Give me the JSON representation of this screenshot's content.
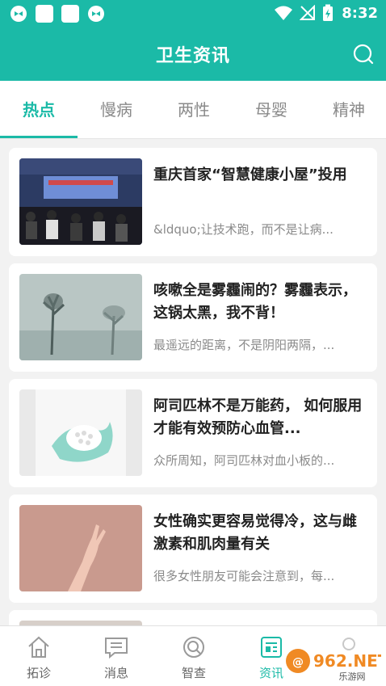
{
  "status_bar": {
    "time": "8:32"
  },
  "app_bar": {
    "title": "卫生资讯"
  },
  "tabs": [
    {
      "label": "热点"
    },
    {
      "label": "慢病"
    },
    {
      "label": "两性"
    },
    {
      "label": "母婴"
    },
    {
      "label": "精神"
    }
  ],
  "articles": [
    {
      "title": "重庆首家“智慧健康小屋”投用",
      "summary": "&ldquo;让技术跑，而不是让病..."
    },
    {
      "title": "咳嗽全是雾霾闹的？雾霾表示，这锅太黑，我不背！",
      "summary": "最遥远的距离，不是阴阳两隔，..."
    },
    {
      "title": "阿司匹林不是万能药， 如何服用才能有效预防心血管...",
      "summary": "众所周知，阿司匹林对血小板的..."
    },
    {
      "title": "女性确实更容易觉得冷，这与雌激素和肌肉量有关",
      "summary": "很多女性朋友可能会注意到，每..."
    }
  ],
  "bottom_nav": [
    {
      "label": "拓诊",
      "icon": "home-icon"
    },
    {
      "label": "消息",
      "icon": "message-icon"
    },
    {
      "label": "智查",
      "icon": "search-icon"
    },
    {
      "label": "资讯",
      "icon": "news-icon"
    },
    {
      "label": "",
      "icon": "profile-icon"
    }
  ],
  "watermark": {
    "text": "962.NET",
    "subtext": "乐游网"
  },
  "colors": {
    "accent": "#1bbaa7",
    "title_text": "#222222",
    "muted_text": "#8a8a8a",
    "watermark": "#f08a24"
  }
}
